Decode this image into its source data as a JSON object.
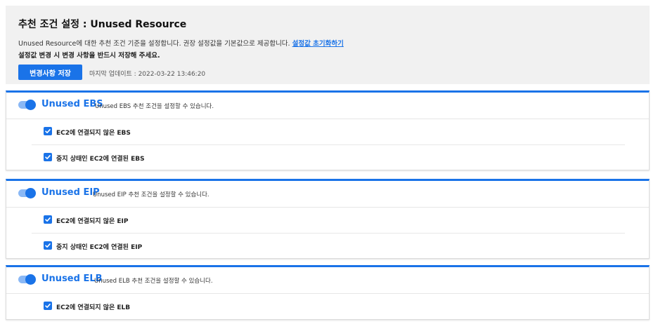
{
  "header": {
    "title": "추천 조건 설정 : Unused Resource",
    "description": "Unused Resource에 대한 추천 조건 기준을 설정합니다. 권장 설정값을 기본값으로 제공합니다.",
    "reset_link": "설정값 초기화하기",
    "warning": "설정값 변경 시 변경 사항을 반드시 저장해 주세요.",
    "save_label": "변경사항 저장",
    "last_update": "마지막 업데이트 : 2022-03-22 13:46:20"
  },
  "colors": {
    "accent": "#1a73e8",
    "header_bg": "#f1f1f1"
  },
  "sections": [
    {
      "title": "Unused EBS",
      "subtitle": "Unused EBS 추천 조건을 설정할 수 있습니다.",
      "enabled": true,
      "items": [
        {
          "label": "EC2에 연결되지 않은 EBS",
          "checked": true
        },
        {
          "label": "중지 상태인 EC2에 연결된 EBS",
          "checked": true
        }
      ]
    },
    {
      "title": "Unused EIP",
      "subtitle": "Unused EIP 추천 조건을 설정할 수 있습니다.",
      "enabled": true,
      "items": [
        {
          "label": "EC2에 연결되지 않은 EIP",
          "checked": true
        },
        {
          "label": "중지 상태인 EC2에 연결된 EIP",
          "checked": true
        }
      ]
    },
    {
      "title": "Unused ELB",
      "subtitle": "Unused ELB 추천 조건을 설정할 수 있습니다.",
      "enabled": true,
      "items": [
        {
          "label": "EC2에 연결되지 않은 ELB",
          "checked": true
        }
      ]
    }
  ]
}
